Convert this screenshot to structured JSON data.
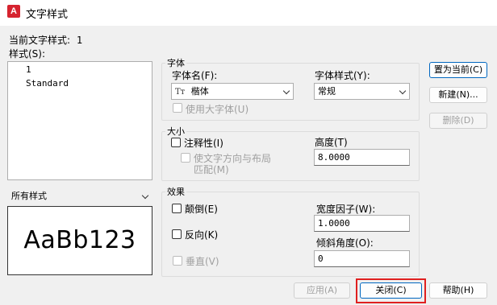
{
  "window": {
    "title": "文字样式"
  },
  "current_style": {
    "label": "当前文字样式:",
    "value": "1"
  },
  "styles": {
    "label": "样式(S):",
    "items": [
      "1",
      "Standard"
    ],
    "filter_value": "所有样式"
  },
  "preview": {
    "text": "AaBb123"
  },
  "font": {
    "group_label": "字体",
    "name_label": "字体名(F):",
    "name_value": "楷体",
    "style_label": "字体样式(Y):",
    "style_value": "常规",
    "bigfont_label": "使用大字体(U)"
  },
  "size": {
    "group_label": "大小",
    "annotative_label": "注释性(I)",
    "match_layout_label_1": "使文字方向与布局",
    "match_layout_label_2": "匹配(M)",
    "height_label": "高度(T)",
    "height_value": "8.0000"
  },
  "effects": {
    "group_label": "效果",
    "upside_down_label": "颠倒(E)",
    "backwards_label": "反向(K)",
    "vertical_label": "垂直(V)",
    "width_factor_label": "宽度因子(W):",
    "width_factor_value": "1.0000",
    "oblique_label": "倾斜角度(O):",
    "oblique_value": "0"
  },
  "buttons": {
    "set_current": "置为当前(C)",
    "new": "新建(N)...",
    "delete": "删除(D)",
    "apply": "应用(A)",
    "close": "关闭(C)",
    "help": "帮助(H)"
  },
  "colors": {
    "accent": "#0067c0",
    "highlight": "#e02020",
    "app_icon": "#d6232f"
  }
}
